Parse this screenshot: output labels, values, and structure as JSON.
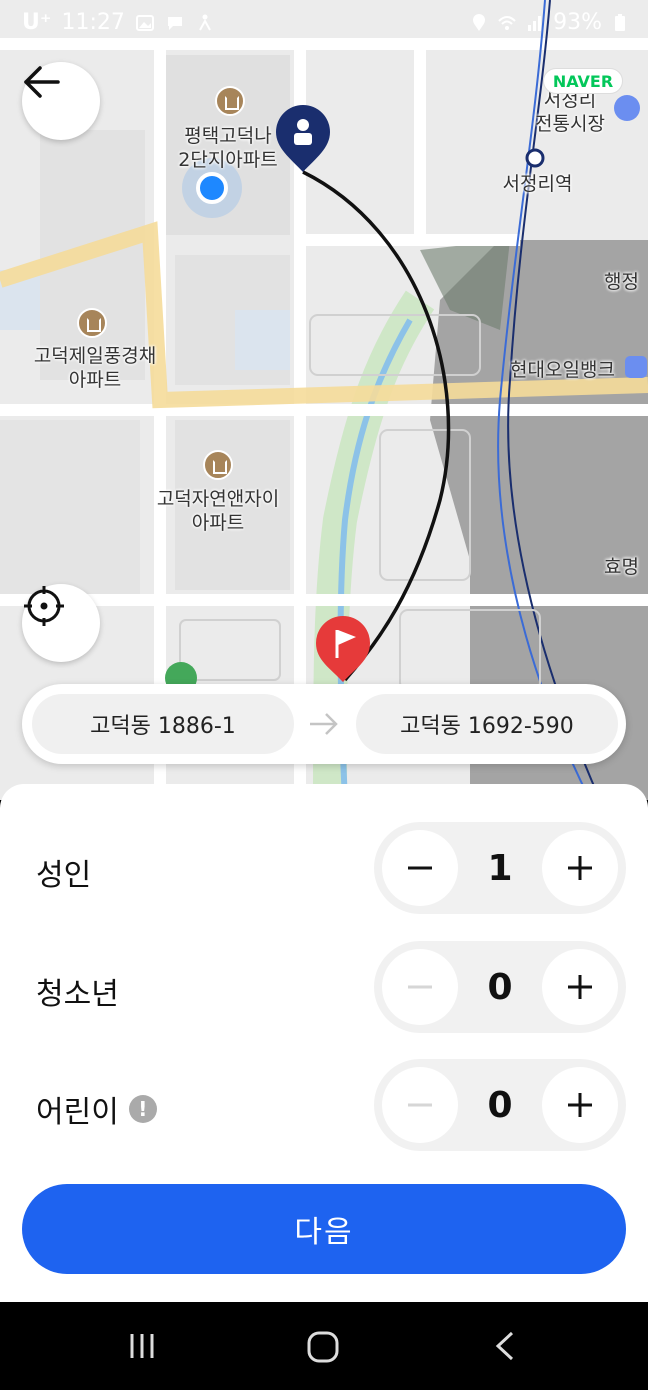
{
  "status_bar": {
    "carrier": "U⁺",
    "time": "11:27",
    "battery": "93%",
    "icons": [
      "gallery-icon",
      "chat-bubble-icon",
      "accessibility-icon",
      "location-icon",
      "wifi-icon",
      "signal-icon",
      "battery-icon"
    ]
  },
  "map": {
    "labels": {
      "apartment_1": "평택고덕나\n2단지아파트",
      "apartment_2": "고덕제일풍경채\n아파트",
      "apartment_3": "고덕자연앤자이\n아파트",
      "market": "서정리\n전통시장",
      "station": "서정리역",
      "admin": "행정",
      "bank": "현대오일뱅크",
      "hyomyeong": "효명"
    },
    "naver_badge": "NAVER",
    "colors": {
      "route": "#111111",
      "origin_pin": "#1a2e6e",
      "destination_pin": "#e63a3a",
      "current_location": "#1e88ff"
    }
  },
  "route_bar": {
    "from": "고덕동 1886-1",
    "to": "고덕동 1692-590"
  },
  "passengers": [
    {
      "label": "성인",
      "value": "1",
      "minus_enabled": true,
      "has_info": false
    },
    {
      "label": "청소년",
      "value": "0",
      "minus_enabled": false,
      "has_info": false
    },
    {
      "label": "어린이",
      "value": "0",
      "minus_enabled": false,
      "has_info": true
    }
  ],
  "next_button": "다음",
  "colors": {
    "primary": "#1e63f0"
  }
}
